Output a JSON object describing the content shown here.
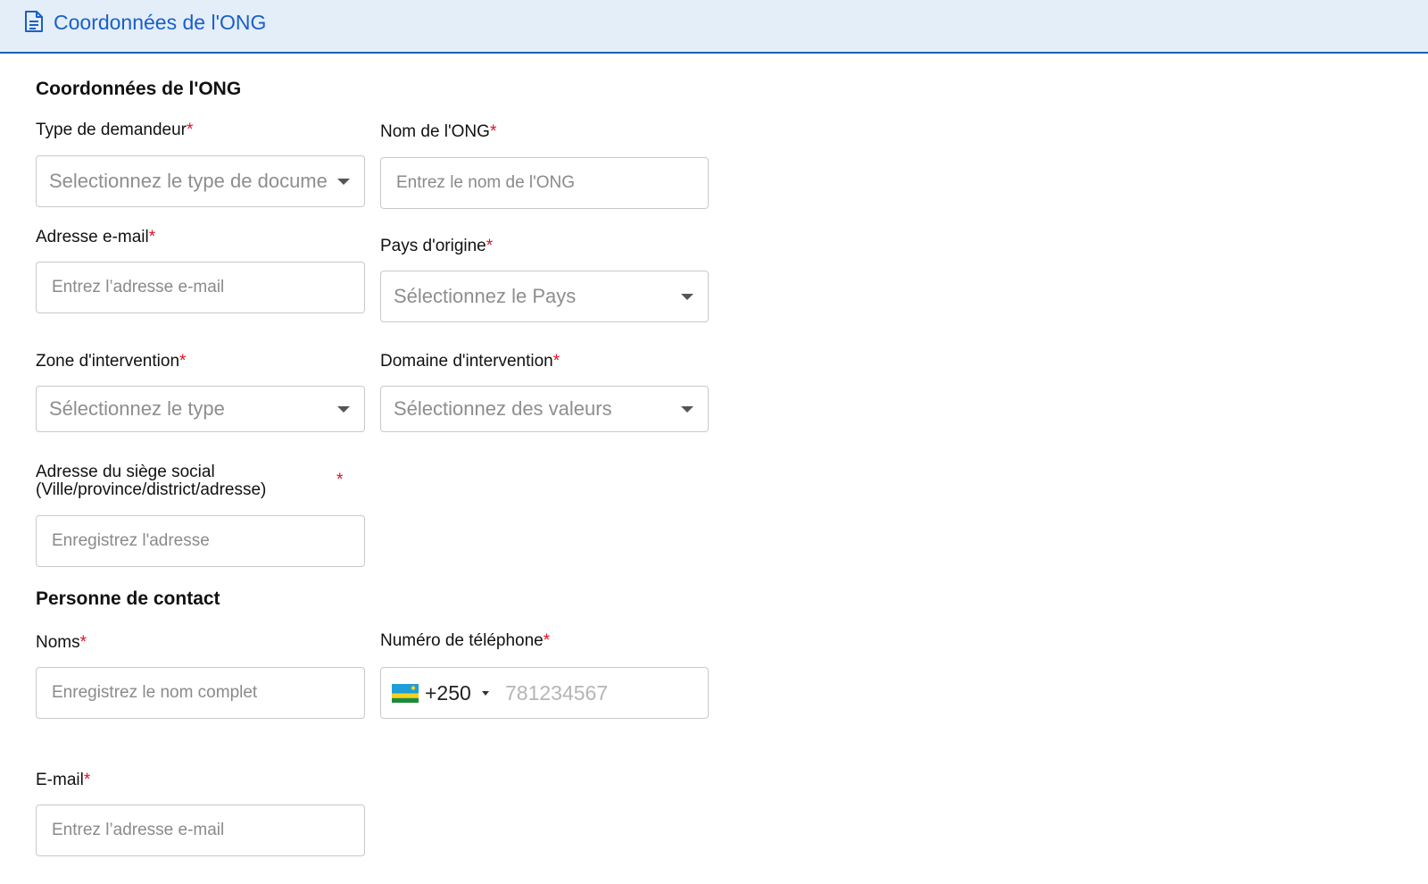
{
  "header": {
    "title": "Coordonnées de l'ONG",
    "icon": "document-icon",
    "accent": "#1a5fc7"
  },
  "sections": {
    "org_title": "Coordonnées de l'ONG",
    "contact_title": "Personne de contact"
  },
  "required_mark": "*",
  "fields": {
    "type_demandeur": {
      "label": "Type de demandeur",
      "placeholder": "Selectionnez le type de document"
    },
    "nom_ong": {
      "label": "Nom de l'ONG",
      "placeholder": "Entrez le nom de l'ONG"
    },
    "adresse_email": {
      "label": "Adresse e-mail",
      "placeholder": "Entrez l’adresse e-mail"
    },
    "pays_origine": {
      "label": "Pays d'origine",
      "placeholder": "Sélectionnez le Pays"
    },
    "zone_intervention": {
      "label": "Zone d'intervention",
      "placeholder": "Sélectionnez le type"
    },
    "domaine_intervention": {
      "label": "Domaine d'intervention",
      "placeholder": "Sélectionnez des valeurs"
    },
    "adresse_siege": {
      "label_line1": "Adresse du siège social",
      "label_line2": "(Ville/province/district/adresse)",
      "placeholder": "Enregistrez l'adresse"
    },
    "noms": {
      "label": "Noms",
      "placeholder": "Enregistrez le nom complet"
    },
    "telephone": {
      "label": "Numéro de téléphone",
      "country_code": "+250",
      "flag": "rwanda-flag-icon",
      "placeholder": "781234567"
    },
    "contact_email": {
      "label": "E-mail",
      "placeholder": "Entrez l’adresse e-mail"
    }
  }
}
